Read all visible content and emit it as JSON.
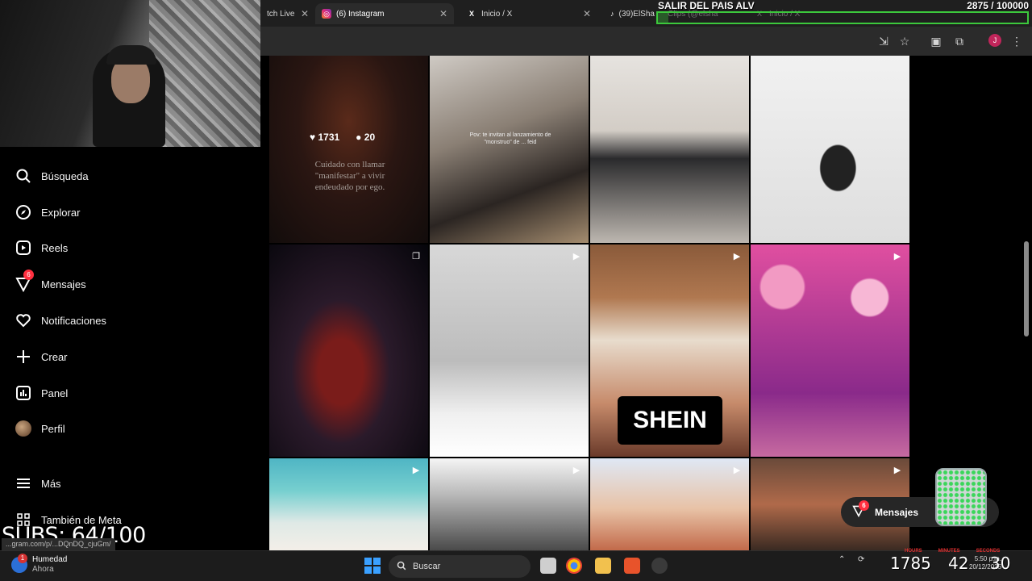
{
  "browser": {
    "tabs": [
      {
        "label": "tch Live",
        "active": false
      },
      {
        "label": "(6) Instagram",
        "active": true
      },
      {
        "label": "Inicio / X",
        "active": false
      },
      {
        "label": "(39)ElSha",
        "active": false
      }
    ],
    "ghost_tabs": [
      "Clips (@elsha",
      "Inicio / X"
    ],
    "profile_initial": "J",
    "status_url": "...gram.com/p/...DQnDQ_cjuGm/"
  },
  "overlay": {
    "goal_title": "SALIR DEL PAIS ALV",
    "goal_count": "2875 / 100000",
    "goal_fraction": 0.02875,
    "subs": "SUBS: 64/100",
    "counter_left": "1785",
    "counter_mid": "42",
    "counter_right": "30",
    "timer_labels": [
      "HOURS",
      "MINUTES",
      "SECONDS"
    ]
  },
  "sidebar": {
    "items": [
      {
        "label": "Búsqueda",
        "icon": "search-icon"
      },
      {
        "label": "Explorar",
        "icon": "compass-icon"
      },
      {
        "label": "Reels",
        "icon": "reels-icon"
      },
      {
        "label": "Mensajes",
        "icon": "messenger-icon",
        "badge": "6"
      },
      {
        "label": "Notificaciones",
        "icon": "heart-icon"
      },
      {
        "label": "Crear",
        "icon": "plus-icon"
      },
      {
        "label": "Panel",
        "icon": "chart-icon"
      },
      {
        "label": "Perfil",
        "icon": "avatar"
      }
    ],
    "more_label": "Más",
    "meta_label": "También de Meta"
  },
  "posts": {
    "hover": {
      "likes": "1731",
      "comments": "20"
    },
    "caption_1": "Cuidado con llamar \"manifestar\" a vivir endeudado por ego.",
    "caption_2": "Pov: te invitan al lanzamiento de \"monstruo\" de ... feid",
    "shein_text": "SHEIN"
  },
  "messages_pill": {
    "label": "Mensajes",
    "badge": "6"
  },
  "taskbar": {
    "weather_label": "Humedad",
    "weather_sub": "Ahora",
    "weather_badge": "1",
    "search_label": "Buscar",
    "clock_time": "5:50 p.m.",
    "clock_date": "20/12/2025"
  }
}
